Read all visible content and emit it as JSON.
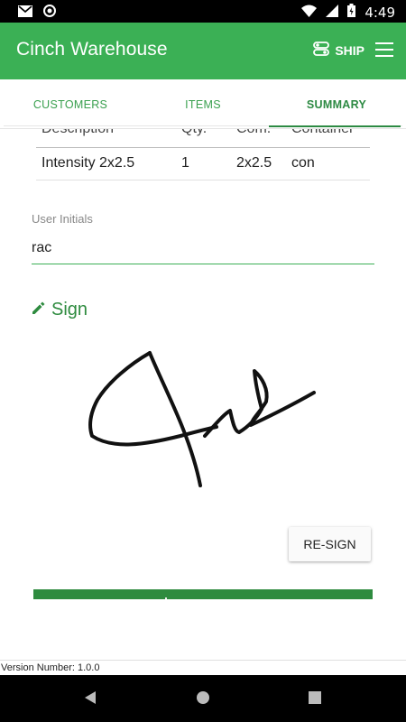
{
  "status_bar": {
    "time": "4:49"
  },
  "app": {
    "title": "Cinch Warehouse",
    "ship_label": "SHIP"
  },
  "tabs": [
    {
      "label": "CUSTOMERS",
      "active": false
    },
    {
      "label": "ITEMS",
      "active": false
    },
    {
      "label": "SUMMARY",
      "active": true
    }
  ],
  "items_table": {
    "headers": [
      "Description",
      "Qty.",
      "Com.",
      "Container"
    ],
    "rows": [
      {
        "description": "Intensity 2x2.5",
        "qty": "1",
        "com": "2x2.5",
        "container": "con"
      }
    ]
  },
  "user_initials": {
    "label": "User Initials",
    "value": "rac"
  },
  "sign": {
    "heading": "Sign",
    "resign_label": "RE-SIGN"
  },
  "footer": {
    "version": "Version Number: 1.0.0"
  },
  "colors": {
    "primary": "#3bb055",
    "accent": "#2e8b3f"
  }
}
